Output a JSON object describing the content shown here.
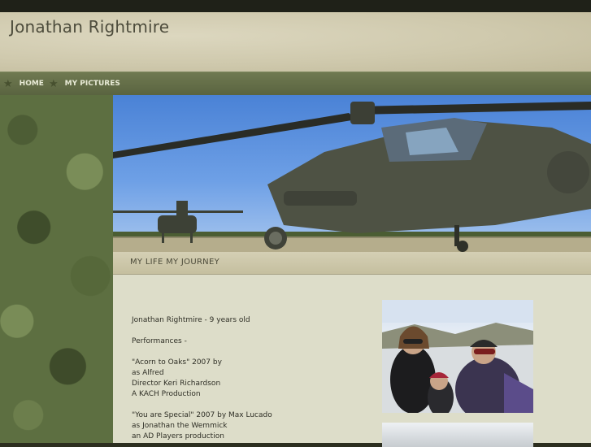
{
  "site": {
    "title": "Jonathan Rightmire"
  },
  "nav": {
    "items": [
      {
        "label": "HOME"
      },
      {
        "label": "MY PICTURES"
      }
    ]
  },
  "page": {
    "subtitle": "MY LIFE MY JOURNEY"
  },
  "content": {
    "lines": [
      "Jonathan Rightmire - 9 years old",
      "",
      "Performances -",
      "",
      "\"Acorn to Oaks\" 2007  by",
      "as Alfred",
      "Director Keri Richardson",
      "A KACH Production",
      "",
      "\"You are Special\" 2007 by Max Lucado",
      "as Jonathan the Wemmick",
      "an AD Players production"
    ]
  },
  "colors": {
    "nav_bg": "#5a6440",
    "header_bg": "#cfc9ad",
    "content_bg": "#ddddc9"
  }
}
